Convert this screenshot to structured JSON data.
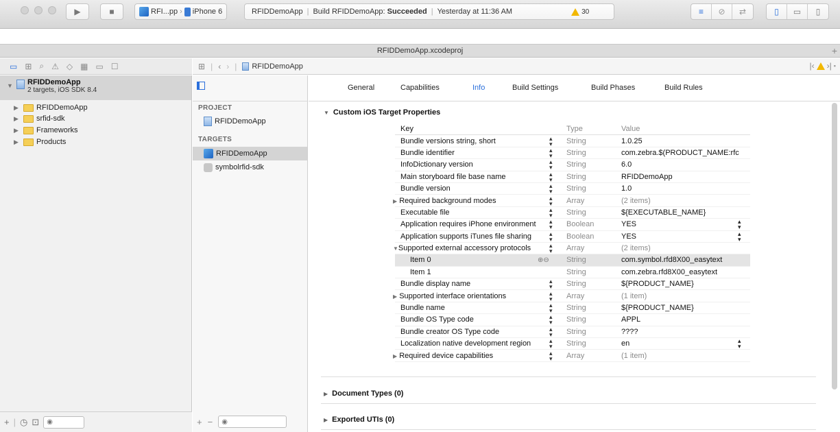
{
  "toolbar": {
    "scheme": "RFI...pp",
    "device": "iPhone 6",
    "activity_app": "RFIDDemoApp",
    "build_prefix": "Build RFIDDemoApp:",
    "build_status": "Succeeded",
    "build_time": "Yesterday at 11:36 AM",
    "warning_count": "30"
  },
  "tabbar": {
    "title": "RFIDDemoApp.xcodeproj"
  },
  "navigator": {
    "project_name": "RFIDDemoApp",
    "project_subtitle": "2 targets, iOS SDK 8.4",
    "items": [
      {
        "label": "RFIDDemoApp"
      },
      {
        "label": "srfid-sdk"
      },
      {
        "label": "Frameworks"
      },
      {
        "label": "Products"
      }
    ]
  },
  "jumpbar": {
    "crumb": "RFIDDemoApp"
  },
  "targets_panel": {
    "project_header": "PROJECT",
    "project_item": "RFIDDemoApp",
    "targets_header": "TARGETS",
    "targets": [
      {
        "label": "RFIDDemoApp",
        "selected": true
      },
      {
        "label": "symbolrfid-sdk",
        "selected": false
      }
    ]
  },
  "tabs": [
    {
      "label": "General"
    },
    {
      "label": "Capabilities"
    },
    {
      "label": "Info"
    },
    {
      "label": "Build Settings"
    },
    {
      "label": "Build Phases"
    },
    {
      "label": "Build Rules"
    }
  ],
  "active_tab": "Info",
  "properties": {
    "section_title": "Custom iOS Target Properties",
    "col_key": "Key",
    "col_type": "Type",
    "col_value": "Value",
    "rows": [
      {
        "key": "Bundle versions string, short",
        "type": "String",
        "value": "1.0.25"
      },
      {
        "key": "Bundle identifier",
        "type": "String",
        "value": "com.zebra.$(PRODUCT_NAME:rfc"
      },
      {
        "key": "InfoDictionary version",
        "type": "String",
        "value": "6.0"
      },
      {
        "key": "Main storyboard file base name",
        "type": "String",
        "value": "RFIDDemoApp"
      },
      {
        "key": "Bundle version",
        "type": "String",
        "value": "1.0"
      },
      {
        "key": "Required background modes",
        "type": "Array",
        "value": "(2 items)"
      },
      {
        "key": "Executable file",
        "type": "String",
        "value": "${EXECUTABLE_NAME}"
      },
      {
        "key": "Application requires iPhone environment",
        "type": "Boolean",
        "value": "YES"
      },
      {
        "key": "Application supports iTunes file sharing",
        "type": "Boolean",
        "value": "YES"
      },
      {
        "key": "Supported external accessory protocols",
        "type": "Array",
        "value": "(2 items)"
      },
      {
        "key": "Item 0",
        "type": "String",
        "value": "com.symbol.rfd8X00_easytext"
      },
      {
        "key": "Item 1",
        "type": "String",
        "value": "com.zebra.rfd8X00_easytext"
      },
      {
        "key": "Bundle display name",
        "type": "String",
        "value": "${PRODUCT_NAME}"
      },
      {
        "key": "Supported interface orientations",
        "type": "Array",
        "value": "(1 item)"
      },
      {
        "key": "Bundle name",
        "type": "String",
        "value": "${PRODUCT_NAME}"
      },
      {
        "key": "Bundle OS Type code",
        "type": "String",
        "value": "APPL"
      },
      {
        "key": "Bundle creator OS Type code",
        "type": "String",
        "value": "????"
      },
      {
        "key": "Localization native development region",
        "type": "String",
        "value": "en"
      },
      {
        "key": "Required device capabilities",
        "type": "Array",
        "value": "(1 item)"
      }
    ]
  },
  "sections": {
    "document_types": "Document Types (0)",
    "exported_utis": "Exported UTIs (0)"
  },
  "colors": {
    "accent": "#2a6fdb",
    "warning": "#f2b800"
  }
}
